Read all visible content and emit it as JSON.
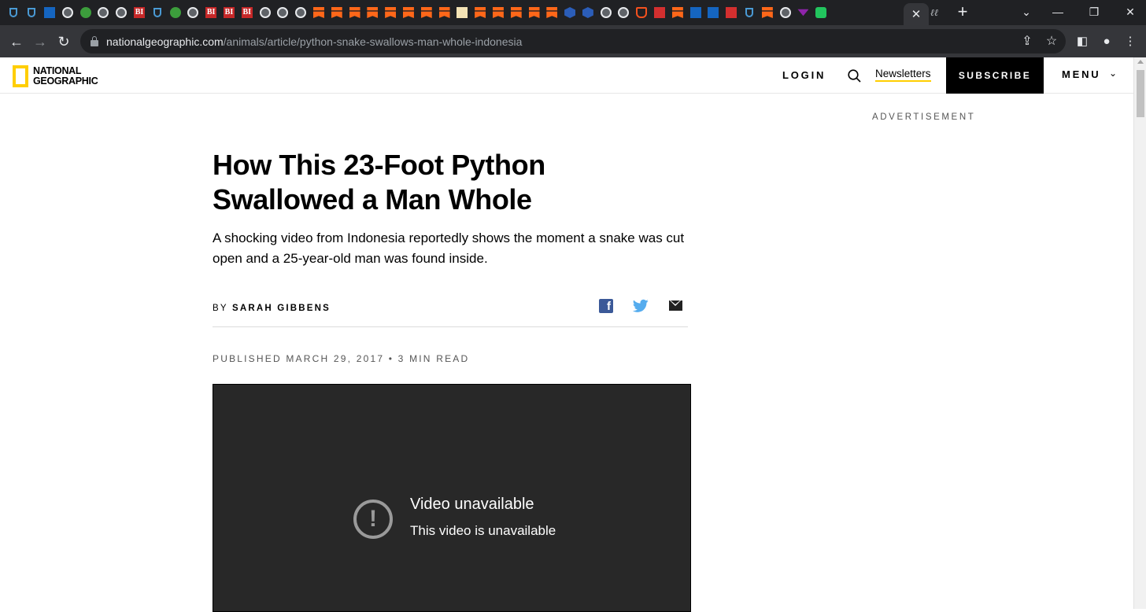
{
  "browser": {
    "url_domain": "nationalgeographic.com",
    "url_path": "/animals/article/python-snake-swallows-man-whole-indonesia",
    "active_tab_close": "✕",
    "new_tab": "+",
    "tab_favicons": [
      "shield",
      "shield",
      "blue",
      "globe",
      "play",
      "globe",
      "globe",
      "bi",
      "shield",
      "play",
      "globe",
      "bi",
      "bi",
      "bi",
      "globe",
      "globe",
      "globe",
      "substack",
      "substack",
      "substack",
      "substack",
      "substack",
      "substack",
      "substack",
      "substack",
      "doc",
      "substack",
      "substack",
      "substack",
      "substack",
      "substack",
      "hex",
      "hex",
      "globe",
      "globe",
      "orange",
      "red",
      "substack",
      "blue",
      "blue",
      "red",
      "shield",
      "substack",
      "globe",
      "purple",
      "green"
    ]
  },
  "site": {
    "logo_line1": "NATIONAL",
    "logo_line2": "GEOGRAPHIC",
    "login": "LOGIN",
    "newsletters": "Newsletters",
    "subscribe": "SUBSCRIBE",
    "menu": "MENU",
    "advertisement": "ADVERTISEMENT"
  },
  "article": {
    "headline": "How This 23-Foot Python Swallowed a Man Whole",
    "dek": "A shocking video from Indonesia reportedly shows the moment a snake was cut open and a 25-year-old man was found inside.",
    "byline_prefix": "BY",
    "author": "SARAH GIBBENS",
    "published": "PUBLISHED MARCH 29, 2017 • 3 MIN READ"
  },
  "video": {
    "title": "Video unavailable",
    "message": "This video is unavailable"
  }
}
